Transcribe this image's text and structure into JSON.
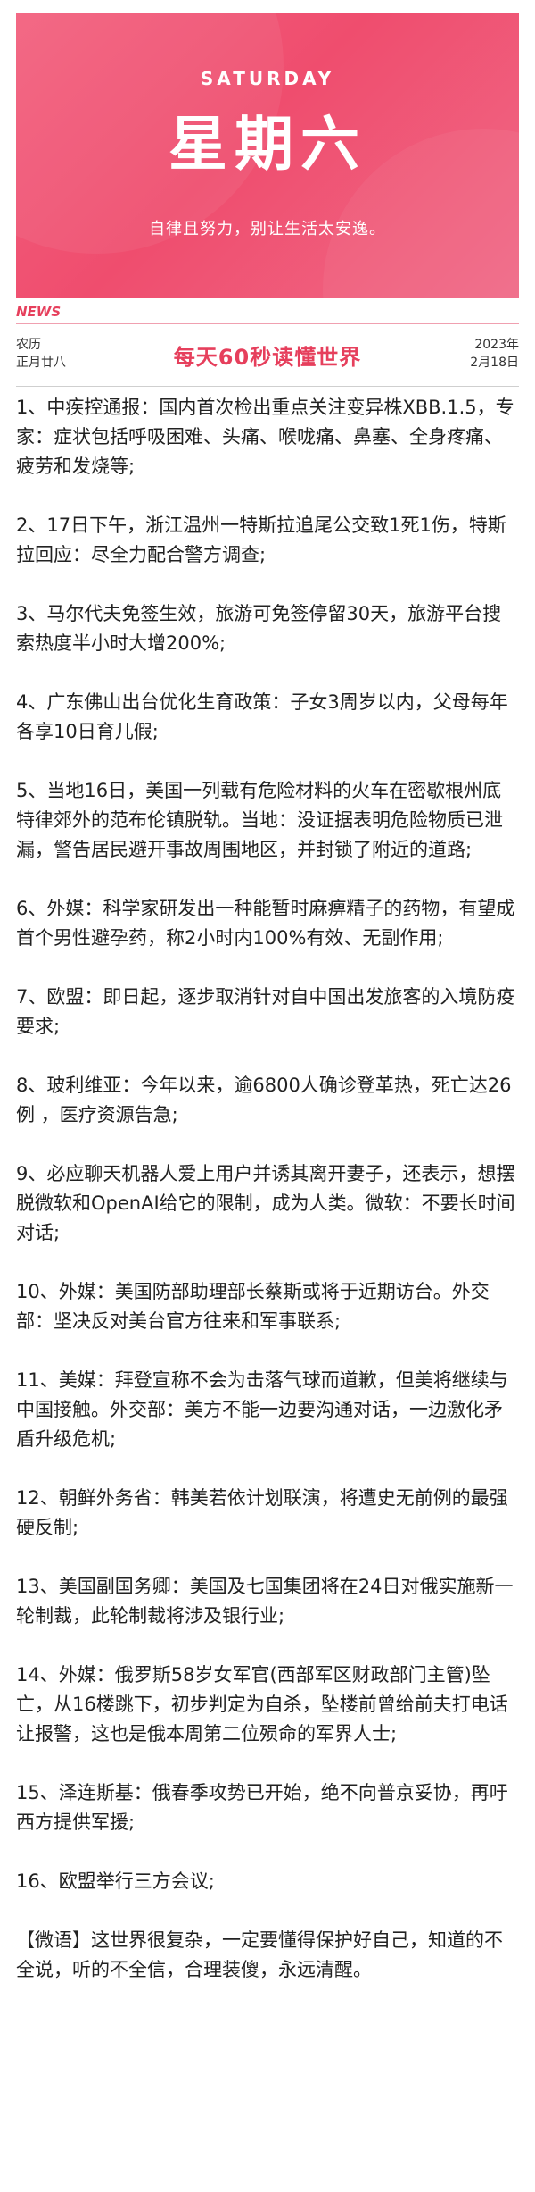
{
  "banner": {
    "weekday_en": "SATURDAY",
    "weekday_cn": "星期六",
    "motto": "自律且努力，别让生活太安逸。"
  },
  "news_tag": "NEWS",
  "header": {
    "lunar_label": "农历",
    "lunar_date": "正月廿八",
    "title": "每天60秒读懂世界",
    "year": "2023年",
    "date": "2月18日"
  },
  "items": [
    "1、中疾控通报：国内首次检出重点关注变异株XBB.1.5，专家：症状包括呼吸困难、头痛、喉咙痛、鼻塞、全身疼痛、疲劳和发烧等;",
    "2、17日下午，浙江温州一特斯拉追尾公交致1死1伤，特斯拉回应：尽全力配合警方调查;",
    "3、马尔代夫免签生效，旅游可免签停留30天，旅游平台搜索热度半小时大增200%;",
    "4、广东佛山出台优化生育政策：子女3周岁以内，父母每年各享10日育儿假;",
    "5、当地16日，美国一列载有危险材料的火车在密歇根州底特律郊外的范布伦镇脱轨。当地：没证据表明危险物质已泄漏，警告居民避开事故周围地区，并封锁了附近的道路;",
    "6、外媒：科学家研发出一种能暂时麻痹精子的药物，有望成首个男性避孕药，称2小时内100%有效、无副作用;",
    "7、欧盟：即日起，逐步取消针对自中国出发旅客的入境防疫要求;",
    "8、玻利维亚：今年以来，逾6800人确诊登革热，死亡达26例 ，医疗资源告急;",
    "9、必应聊天机器人爱上用户并诱其离开妻子，还表示，想摆脱微软和OpenAI给它的限制，成为人类。微软：不要长时间对话;",
    "10、外媒：美国防部助理部长蔡斯或将于近期访台。外交部：坚决反对美台官方往来和军事联系;",
    "11、美媒：拜登宣称不会为击落气球而道歉，但美将继续与中国接触。外交部：美方不能一边要沟通对话，一边激化矛盾升级危机;",
    "12、朝鲜外务省：韩美若依计划联演，将遭史无前例的最强硬反制;",
    "13、美国副国务卿：美国及七国集团将在24日对俄实施新一轮制裁，此轮制裁将涉及银行业;",
    "14、外媒：俄罗斯58岁女军官(西部军区财政部门主管)坠亡，从16楼跳下，初步判定为自杀，坠楼前曾给前夫打电话让报警，这也是俄本周第二位殒命的军界人士;",
    "15、泽连斯基：俄春季攻势已开始，绝不向普京妥协，再吁西方提供军援;",
    "16、欧盟举行三方会议;",
    "【微语】这世界很复杂，一定要懂得保护好自己，知道的不全说，听的不全信，合理装傻，永远清醒。"
  ]
}
